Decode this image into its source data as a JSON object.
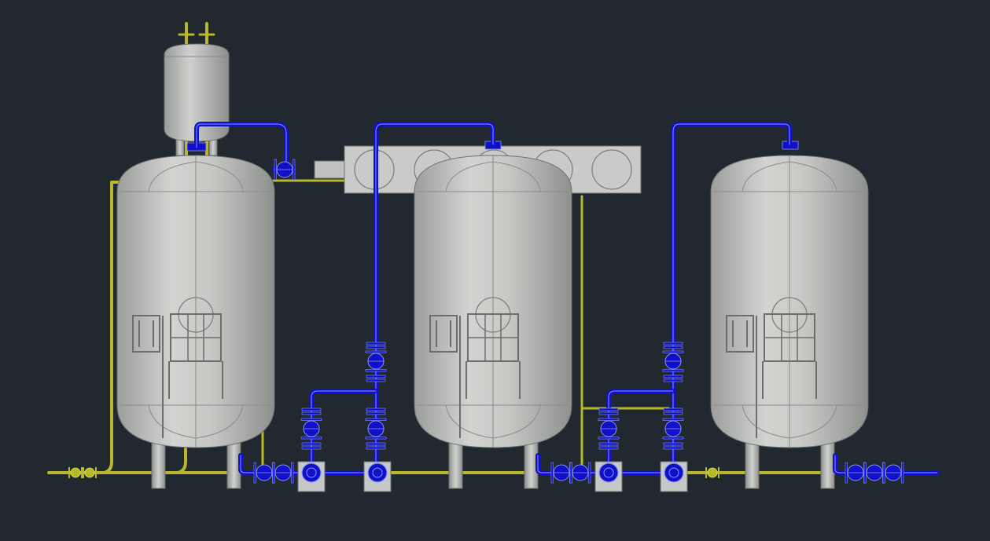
{
  "viewport": {
    "background": "#212830"
  },
  "colors": {
    "vessel_fill": "#b9bbb8",
    "vessel_fill_light": "#d6d8d5",
    "vessel_edge": "#6e716f",
    "process_pipe": "#1010c8",
    "process_pipe_edge": "#7a86ff",
    "utility_pipe": "#b8b82a",
    "utility_pipe_edge": "#e8e870",
    "steel": "#c9cbc9"
  },
  "equipment": {
    "vessels": [
      {
        "id": "tank-1",
        "type": "vertical-pressure-vessel"
      },
      {
        "id": "tank-2",
        "type": "vertical-pressure-vessel"
      },
      {
        "id": "tank-3",
        "type": "vertical-pressure-vessel"
      }
    ],
    "separator": {
      "id": "air-separator",
      "type": "small-vertical-vessel"
    },
    "silencer": {
      "id": "silencer-box",
      "type": "horizontal-box",
      "circle_count": 5
    },
    "pumps": [
      {
        "id": "pump-1"
      },
      {
        "id": "pump-2"
      },
      {
        "id": "pump-3"
      },
      {
        "id": "pump-4"
      }
    ]
  }
}
